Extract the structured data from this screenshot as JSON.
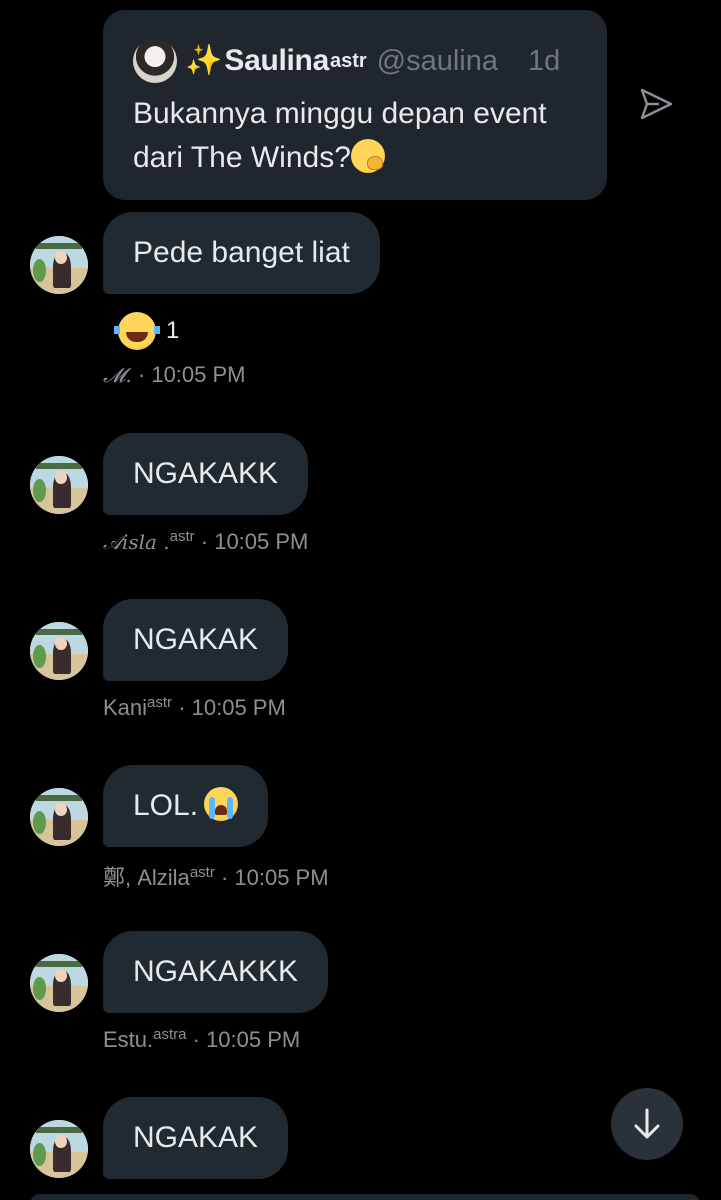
{
  "quote": {
    "sparkle": "✨",
    "name": "Saulina",
    "name_sup": "astr",
    "handle": "@saulina",
    "time": "1d",
    "text": "Bukannya minggu depan event dari The Winds?"
  },
  "messages": [
    {
      "text": "Pede banget liat",
      "reaction": {
        "emoji": "joy-emoji",
        "count": "1"
      },
      "sender": "𝓜.",
      "sender_sup": "",
      "time": "· 10:05 PM"
    },
    {
      "text": "NGAKAKK",
      "sender": "𝒜isla .",
      "sender_sup": "astr",
      "time": "· 10:05 PM"
    },
    {
      "text": "NGAKAK",
      "sender": "Kani",
      "sender_sup": "astr",
      "time": "· 10:05 PM"
    },
    {
      "text": "LOL.",
      "sender": "鄭, Alzila",
      "sender_sup": "astr",
      "time": "· 10:05 PM"
    },
    {
      "text": "NGAKAKKK",
      "sender": "Estu.",
      "sender_sup": "astra",
      "time": "· 10:05 PM"
    },
    {
      "text": "NGAKAK"
    }
  ],
  "colors": {
    "background": "#000000",
    "bubble": "#222a31",
    "quote_card": "#1f262d",
    "meta_text": "#8b9096",
    "primary_text": "#e7e9ea"
  }
}
